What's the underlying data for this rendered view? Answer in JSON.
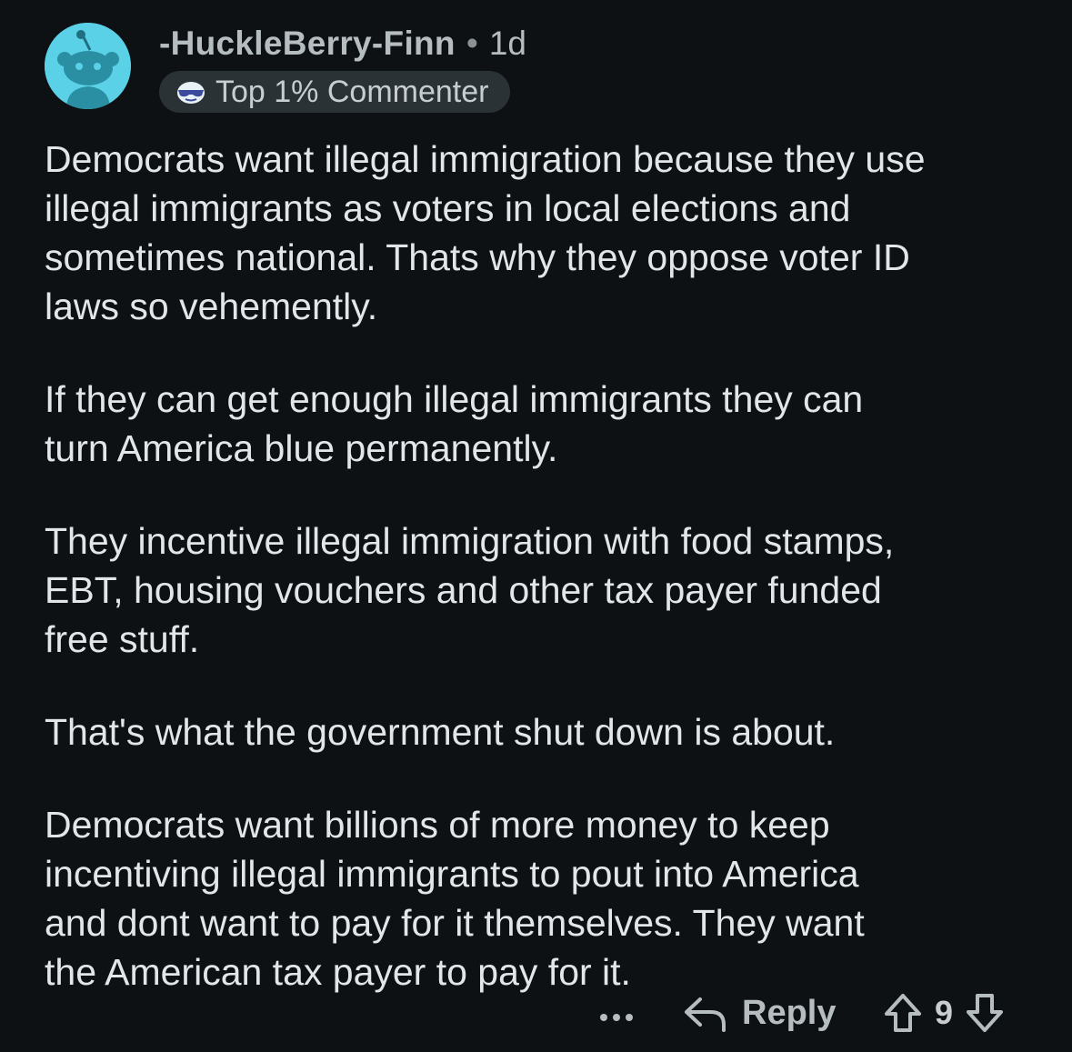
{
  "comment": {
    "author": "-HuckleBerry-Finn",
    "separator": "•",
    "age": "1d",
    "badge": {
      "icon": "sunglasses-emoji-icon",
      "label": "Top 1% Commenter"
    },
    "avatar": {
      "icon": "snoo-avatar-icon",
      "background": "#5ad1e6"
    },
    "paragraphs": [
      "Democrats want illegal immigration because they use\nillegal immigrants as voters in local elections and\nsometimes national. Thats why they oppose voter ID\nlaws so vehemently.",
      "If they can get enough illegal immigrants they can\nturn America blue permanently.",
      "They incentive illegal immigration with food stamps,\nEBT, housing vouchers and other tax payer funded\nfree stuff.",
      "That's what the government shut down is about.",
      "Democrats want billions of more money  to keep\nincentiving illegal immigrants to pout into America\nand dont want to pay for it themselves. They want\nthe American tax payer to pay for it."
    ]
  },
  "actions": {
    "more_icon": "more-options-icon",
    "reply_icon": "reply-arrow-icon",
    "reply_label": "Reply",
    "upvote_icon": "upvote-arrow-icon",
    "score": "9",
    "downvote_icon": "downvote-arrow-icon"
  },
  "colors": {
    "background": "#0e1113",
    "text": "#e3e6e8",
    "muted": "#b6bdc1",
    "badge_bg": "#2a3236"
  }
}
